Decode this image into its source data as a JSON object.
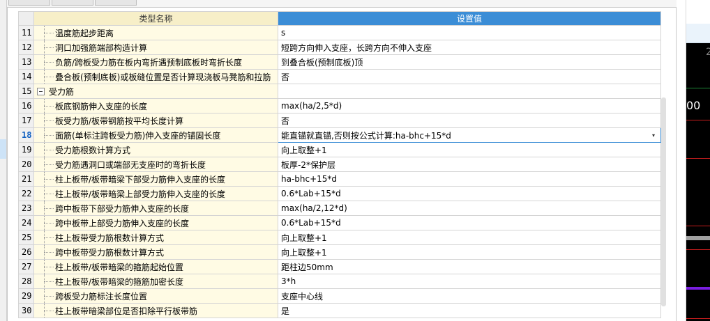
{
  "header": {
    "name_col": "类型名称",
    "value_col": "设置值"
  },
  "rows": [
    {
      "num": "11",
      "name": "温度筋起步距离",
      "value": "s",
      "type": "item"
    },
    {
      "num": "12",
      "name": "洞口加强筋端部构造计算",
      "value": "短跨方向伸入支座，长跨方向不伸入支座",
      "type": "item"
    },
    {
      "num": "13",
      "name": "负筋/跨板受力筋在板内弯折遇预制底板时弯折长度",
      "value": "到叠合板(预制底板)顶",
      "type": "item"
    },
    {
      "num": "14",
      "name": "叠合板(预制底板)或板缝位置是否计算现浇板马凳筋和拉筋",
      "value": "否",
      "type": "item"
    },
    {
      "num": "15",
      "name": "受力筋",
      "value": "",
      "type": "group"
    },
    {
      "num": "16",
      "name": "板底钢筋伸入支座的长度",
      "value": "max(ha/2,5*d)",
      "type": "item"
    },
    {
      "num": "17",
      "name": "板受力筋/板带钢筋按平均长度计算",
      "value": "否",
      "type": "item"
    },
    {
      "num": "18",
      "name": "面筋(单标注跨板受力筋)伸入支座的锚固长度",
      "value": "能直锚就直锚,否则按公式计算:ha-bhc+15*d",
      "type": "selected"
    },
    {
      "num": "19",
      "name": "受力筋根数计算方式",
      "value": "向上取整+1",
      "type": "item"
    },
    {
      "num": "20",
      "name": "受力筋遇洞口或端部无支座时的弯折长度",
      "value": "板厚-2*保护层",
      "type": "item"
    },
    {
      "num": "21",
      "name": "柱上板带/板带暗梁下部受力筋伸入支座的长度",
      "value": "ha-bhc+15*d",
      "type": "item"
    },
    {
      "num": "22",
      "name": "柱上板带/板带暗梁上部受力筋伸入支座的长度",
      "value": "0.6*Lab+15*d",
      "type": "item"
    },
    {
      "num": "23",
      "name": "跨中板带下部受力筋伸入支座的长度",
      "value": "max(ha/2,12*d)",
      "type": "item"
    },
    {
      "num": "24",
      "name": "跨中板带上部受力筋伸入支座的长度",
      "value": "0.6*Lab+15*d",
      "type": "item"
    },
    {
      "num": "25",
      "name": "柱上板带受力筋根数计算方式",
      "value": "向上取整+1",
      "type": "item"
    },
    {
      "num": "26",
      "name": "跨中板带受力筋根数计算方式",
      "value": "向上取整+1",
      "type": "item"
    },
    {
      "num": "27",
      "name": "柱上板带/板带暗梁的箍筋起始位置",
      "value": "距柱边50mm",
      "type": "item"
    },
    {
      "num": "28",
      "name": "柱上板带/板带暗梁的箍筋加密长度",
      "value": "3*h",
      "type": "item"
    },
    {
      "num": "29",
      "name": "跨板受力筋标注长度位置",
      "value": "支座中心线",
      "type": "item"
    },
    {
      "num": "30",
      "name": "柱上板带暗梁部位是否扣除平行板带筋",
      "value": "是",
      "type": "item"
    }
  ],
  "dropdown_icon": "chevron-down-icon",
  "right_canvas": {
    "top_label": "2",
    "side_label": "00",
    "background": "#000000",
    "lines": [
      {
        "color": "#1e8a3a"
      },
      {
        "color": "#c81e1e"
      },
      {
        "color": "#c81e1e"
      },
      {
        "color": "#c81e1e"
      },
      {
        "color": "#c81e1e"
      },
      {
        "color": "#a0a0a0"
      },
      {
        "color": "#7a1ee0"
      },
      {
        "color": "#c81e1e"
      }
    ]
  },
  "colors": {
    "header_value_bg": "#3b8dd6",
    "name_cell_bg": "#fffbe4",
    "selected_num": "#1060c0"
  }
}
